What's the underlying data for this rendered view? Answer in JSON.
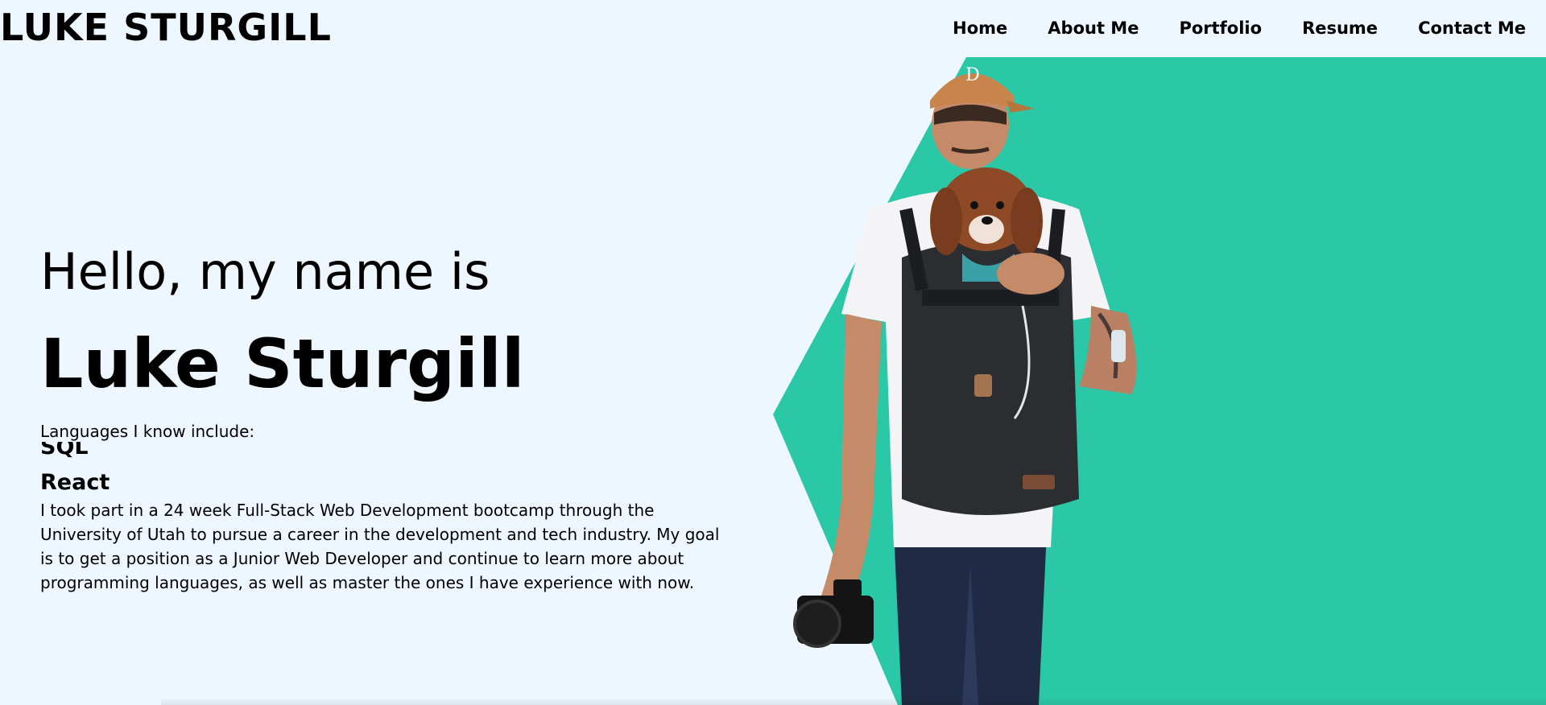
{
  "header": {
    "logo": "LUKE STURGILL",
    "nav": [
      {
        "label": "Home"
      },
      {
        "label": "About Me"
      },
      {
        "label": "Portfolio"
      },
      {
        "label": "Resume"
      },
      {
        "label": "Contact Me"
      }
    ]
  },
  "hero": {
    "greeting": "Hello, my name is",
    "name": "Luke Sturgill",
    "languages_label": "Languages I know include:",
    "languages_visible": [
      "SQL",
      "React"
    ],
    "bio": "I took part in a 24 week Full-Stack Web Development bootcamp through the University of Utah to pursue a career in the development and tech industry. My goal is to get a position as a Junior Web Developer and continue to learn more about programming languages, as well as master the ones I have experience with now."
  },
  "colors": {
    "background": "#eef6ff",
    "accent": "#2bc8a8",
    "text": "#000000"
  },
  "icons": {
    "hero_photo": "person-with-dog-photo"
  }
}
